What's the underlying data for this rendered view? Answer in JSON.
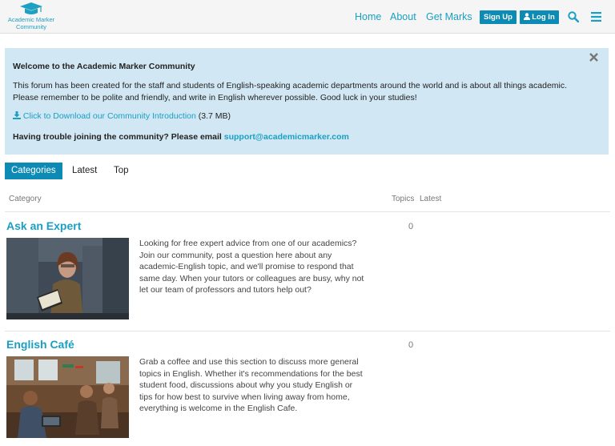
{
  "header": {
    "logo_line1": "Academic Marker",
    "logo_line2": "Community",
    "nav": {
      "home": "Home",
      "about": "About",
      "get_marks": "Get Marks"
    },
    "signup_label": "Sign Up",
    "login_label": "Log In",
    "colors": {
      "accent": "#1a9fc4",
      "button": "#0e8bb5",
      "header_bg": "#f5f5f5"
    }
  },
  "banner": {
    "title": "Welcome to the Academic Marker Community",
    "text": "This forum has been created for the staff and students of English-speaking academic departments around the world and is about all things academic. Please remember to be polite and friendly, and write in English wherever possible. Good luck in your studies!",
    "download_link": "Click to Download our Community Introduction",
    "download_size": "(3.7 MB)",
    "trouble_text": "Having trouble joining the community? Please email",
    "email": "support@academicmarker.com",
    "bg_color": "#d1e7f3"
  },
  "tabs": [
    "Categories",
    "Latest",
    "Top"
  ],
  "table": {
    "col_category": "Category",
    "col_topics": "Topics",
    "col_latest": "Latest"
  },
  "categories": [
    {
      "title": "Ask an Expert",
      "description": "Looking for free expert advice from one of our academics? Join our community, post a question here about any academic-English topic, and we'll promise to respond that same day. When your tutors or colleagues are busy, why not let our team of professors and tutors help out?",
      "topics": "0"
    },
    {
      "title": "English Café",
      "description": "Grab a coffee and use this section to discuss more general topics in English. Whether it's recommendations for the best student food, discussions about why you study English or tips for how best to survive when living away from home, everything is welcome in the English Cafe.",
      "topics": "0"
    }
  ]
}
